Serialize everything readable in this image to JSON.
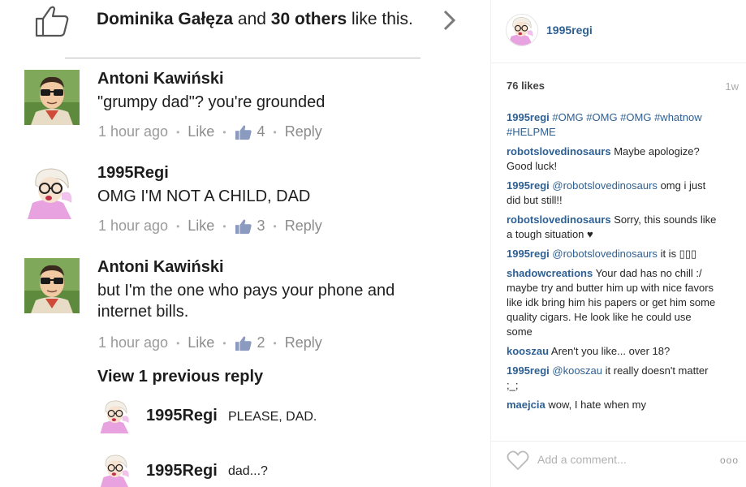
{
  "fb": {
    "likes": {
      "name": "Dominika Gałęza",
      "and": "and",
      "count_text": "30 others",
      "suffix": "like this."
    },
    "comments": [
      {
        "author": "Antoni Kawiński",
        "text": "\"grumpy dad\"? you're grounded",
        "time": "1 hour ago",
        "like": "Like",
        "likes": "4",
        "reply": "Reply"
      },
      {
        "author": "1995Regi",
        "text": "OMG I'M NOT A CHILD, DAD",
        "time": "1 hour ago",
        "like": "Like",
        "likes": "3",
        "reply": "Reply"
      },
      {
        "author": "Antoni Kawiński",
        "text": "but I'm the one who pays your phone and internet bills.",
        "time": "1 hour ago",
        "like": "Like",
        "likes": "2",
        "reply": "Reply"
      }
    ],
    "view_previous": "View 1 previous reply",
    "replies": [
      {
        "author": "1995Regi",
        "text": "PLEASE, DAD."
      },
      {
        "author": "1995Regi",
        "text": "dad...?"
      }
    ]
  },
  "ig": {
    "username": "1995regi",
    "likes": "76 likes",
    "time": "1w",
    "caption": {
      "user": "1995regi",
      "text": "#OMG #OMG #OMG #whatnow #HELPME"
    },
    "comments": [
      {
        "user": "robotslovedinosaurs",
        "text": "Maybe apologize? Good luck!"
      },
      {
        "user": "1995regi",
        "mention": "@robotslovedinosaurs",
        "text": "omg i just did but still!!"
      },
      {
        "user": "robotslovedinosaurs",
        "text": "Sorry, this sounds like a tough situation ♥"
      },
      {
        "user": "1995regi",
        "mention": "@robotslovedinosaurs",
        "text": "it is ▯▯▯"
      },
      {
        "user": "shadowcreations",
        "text": "Your dad has no chill :/ maybe try and butter him up with nice favors like idk bring him his papers or get him some quality cigars. He look like he could use some"
      },
      {
        "user": "kooszau",
        "text": "Aren't you like... over 18?"
      },
      {
        "user": "1995regi",
        "mention": "@kooszau",
        "text": "it really doesn't matter ;_;"
      },
      {
        "user": "maejcia",
        "text": "wow, I hate when my"
      }
    ],
    "add_comment_placeholder": "Add a comment...",
    "more": "ooo"
  },
  "colors": {
    "ig_link": "#2f6093",
    "fb_meta": "#9a9a9a",
    "fb_thumb": "#8a9bbf"
  }
}
